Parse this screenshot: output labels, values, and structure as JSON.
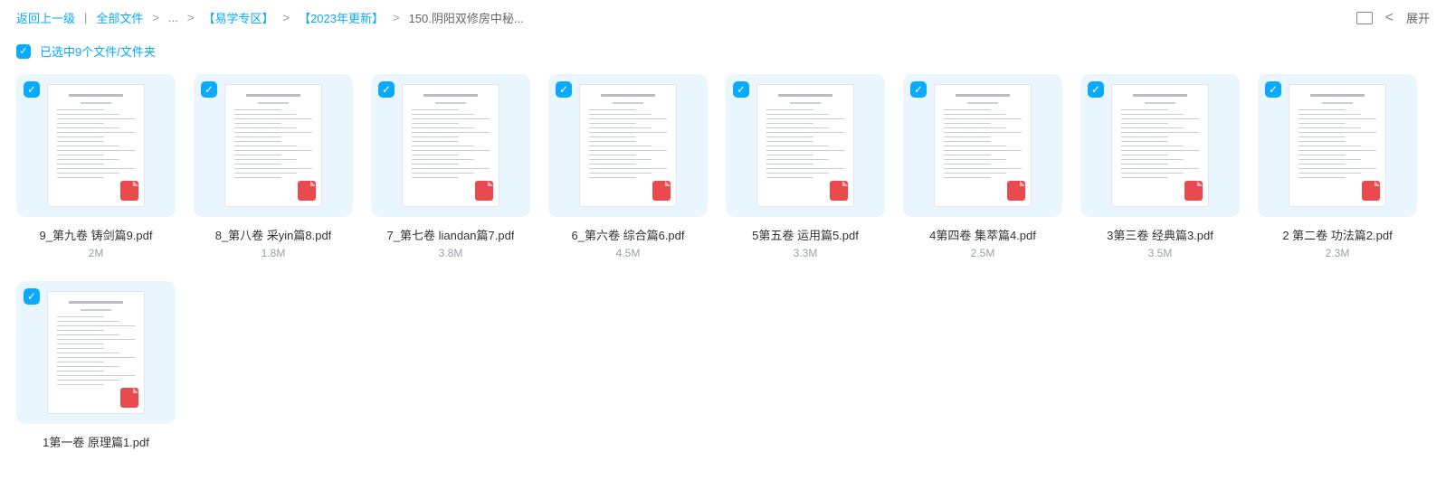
{
  "breadcrumb": {
    "back": "返回上一级",
    "sep_pipe": "|",
    "root": "全部文件",
    "ellipsis": "...",
    "path1": "【易学专区】",
    "path2": "【2023年更新】",
    "current": "150.阴阳双修房中秘...",
    "expand": "展开"
  },
  "selection": {
    "text": "已选中9个文件/文件夹"
  },
  "files": [
    {
      "name": "9_第九卷 铸剑篇9.pdf",
      "size": "2M"
    },
    {
      "name": "8_第八卷 采yin篇8.pdf",
      "size": "1.8M"
    },
    {
      "name": "7_第七卷 liandan篇7.pdf",
      "size": "3.8M"
    },
    {
      "name": "6_第六卷 综合篇6.pdf",
      "size": "4.5M"
    },
    {
      "name": "5第五卷 运用篇5.pdf",
      "size": "3.3M"
    },
    {
      "name": "4第四卷 集萃篇4.pdf",
      "size": "2.5M"
    },
    {
      "name": "3第三卷 经典篇3.pdf",
      "size": "3.5M"
    },
    {
      "name": "2 第二卷 功法篇2.pdf",
      "size": "2.3M"
    },
    {
      "name": "1第一卷 原理篇1.pdf",
      "size": ""
    }
  ],
  "badge": {
    "label": "PDF"
  }
}
